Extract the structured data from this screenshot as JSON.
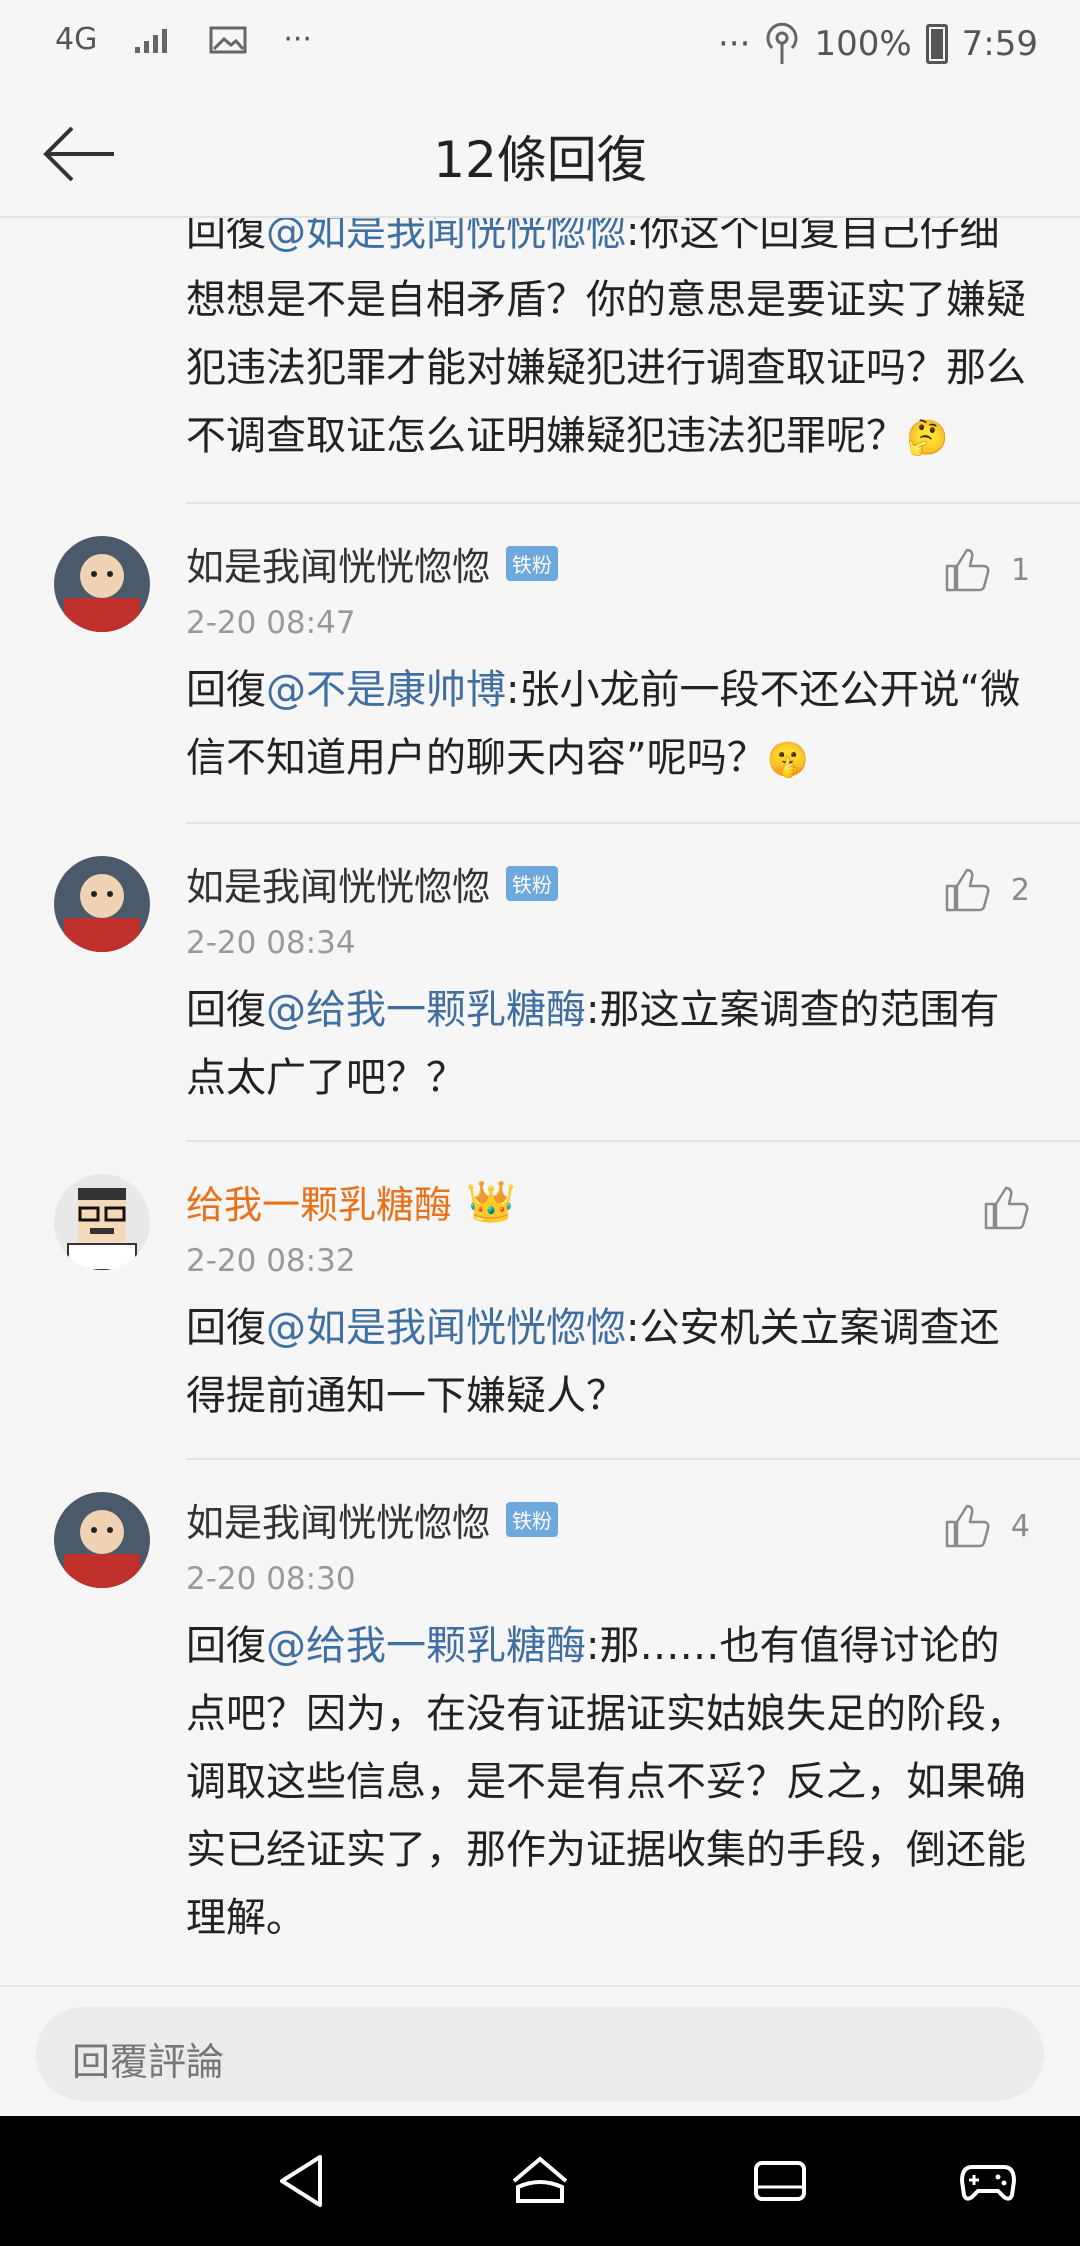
{
  "status_bar": {
    "network": "4G",
    "more": "···",
    "battery": "100%",
    "time": "7:59"
  },
  "header": {
    "title": "12條回復"
  },
  "partial_reply": {
    "prefix": "回復",
    "mention": "@如是我闻恍恍惚惚",
    "text": ":你这个回复自己仔细想想是不是自相矛盾？你的意思是要证实了嫌疑犯违法犯罪才能对嫌疑犯进行调查取证吗？那么不调查取证怎么证明嫌疑犯违法犯罪呢？",
    "emoji": "🤔"
  },
  "replies": [
    {
      "name": "如是我闻恍恍惚惚",
      "badge": "铁粉",
      "likes": "1",
      "time": "2-20 08:47",
      "prefix": "回復",
      "mention": "@不是康帅博",
      "text": ":张小龙前一段不还公开说“微信不知道用户的聊天内容”呢吗？",
      "emoji": "🤫"
    },
    {
      "name": "如是我闻恍恍惚惚",
      "badge": "铁粉",
      "likes": "2",
      "time": "2-20 08:34",
      "prefix": "回復",
      "mention": "@给我一颗乳糖酶",
      "text": ":那这立案调查的范围有点太广了吧？？"
    },
    {
      "name": "给我一颗乳糖酶",
      "crown": "👑",
      "time": "2-20 08:32",
      "prefix": "回復",
      "mention": "@如是我闻恍恍惚惚",
      "text": ":公安机关立案调查还得提前通知一下嫌疑人？"
    },
    {
      "name": "如是我闻恍恍惚惚",
      "badge": "铁粉",
      "likes": "4",
      "time": "2-20 08:30",
      "prefix": "回復",
      "mention": "@给我一颗乳糖酶",
      "text": ":那……也有值得讨论的点吧？因为，在没有证据证实姑娘失足的阶段，调取这些信息，是不是有点不妥？反之，如果确实已经证实了，那作为证据收集的手段，倒还能理解。"
    }
  ],
  "input": {
    "placeholder": "回覆評論"
  }
}
